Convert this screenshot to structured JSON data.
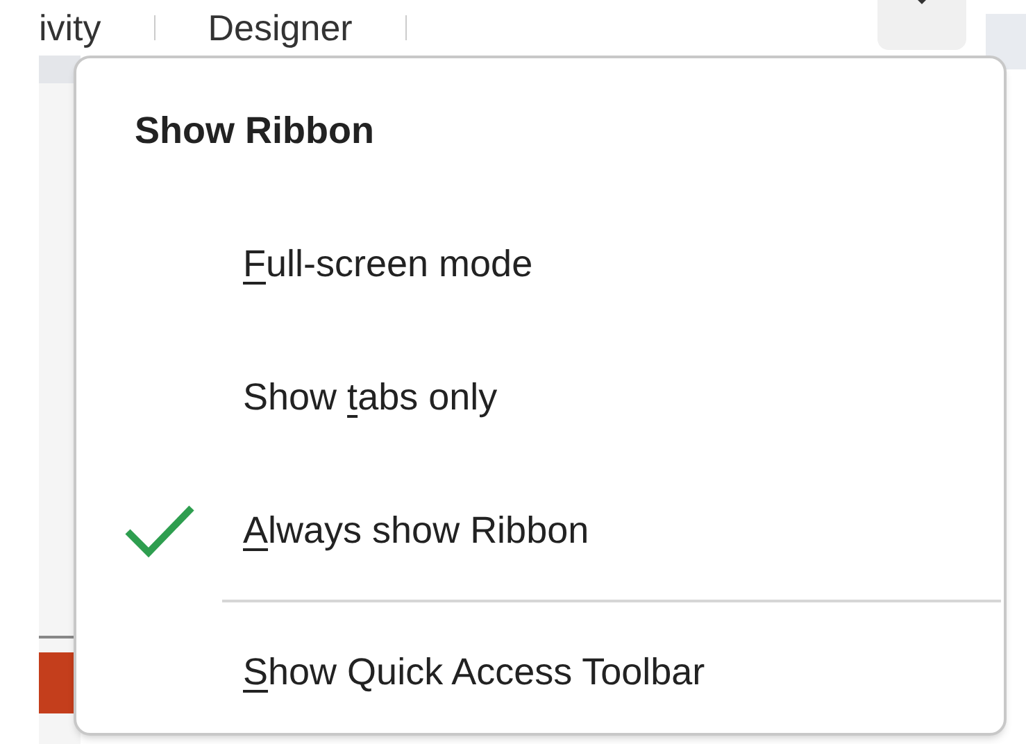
{
  "ribbon_tabs": [
    {
      "label": "ivity"
    },
    {
      "label": "Designer"
    }
  ],
  "menu": {
    "title": "Show Ribbon",
    "items": [
      {
        "key": "F",
        "after": "ull-screen mode",
        "checked": false,
        "separator_before": false
      },
      {
        "before": "Show ",
        "key": "t",
        "after": "abs only",
        "checked": false,
        "separator_before": false
      },
      {
        "key": "A",
        "after": "lways show Ribbon",
        "checked": true,
        "separator_before": false
      },
      {
        "key": "S",
        "after": "how Quick Access Toolbar",
        "checked": false,
        "separator_before": true
      }
    ]
  }
}
